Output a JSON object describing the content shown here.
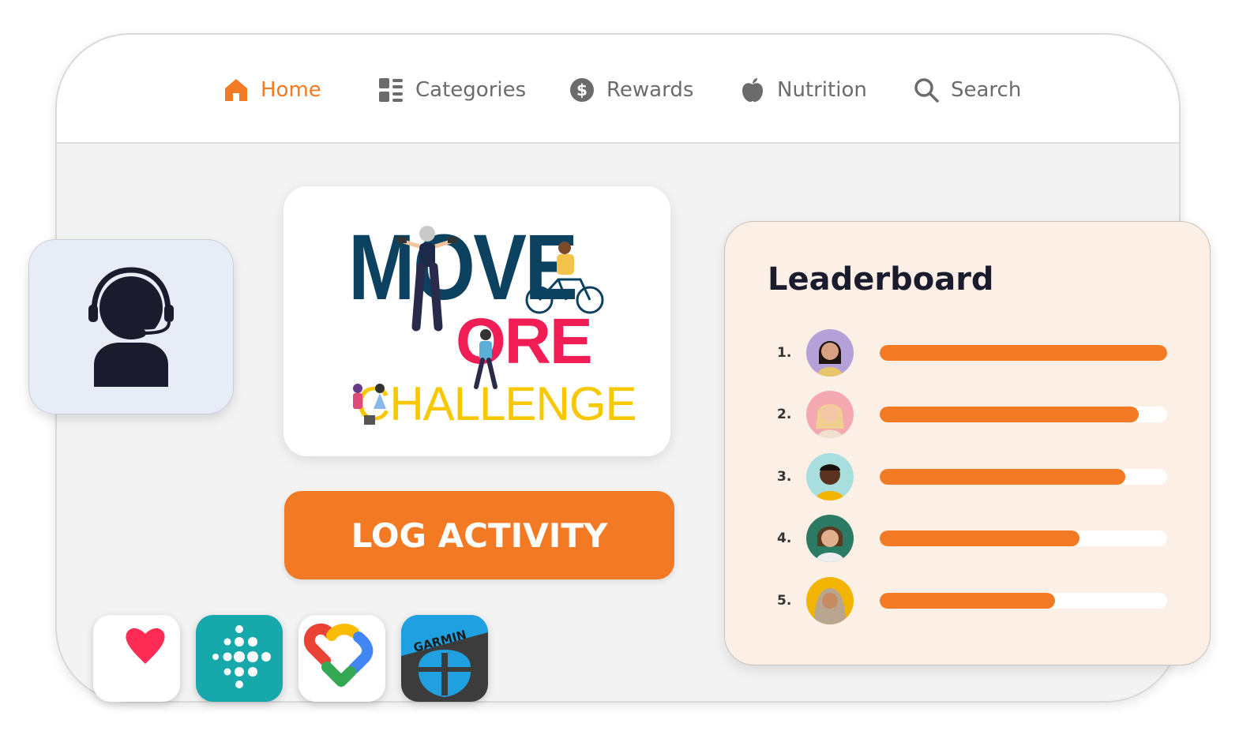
{
  "nav": {
    "items": [
      {
        "label": "Home",
        "icon": "home-icon",
        "active": true
      },
      {
        "label": "Categories",
        "icon": "categories-icon",
        "active": false
      },
      {
        "label": "Rewards",
        "icon": "dollar-coin-icon",
        "active": false
      },
      {
        "label": "Nutrition",
        "icon": "apple-icon",
        "active": false
      },
      {
        "label": "Search",
        "icon": "search-icon",
        "active": false
      }
    ]
  },
  "challenge": {
    "logo_line1": "MOVE",
    "logo_line2": "ORE",
    "logo_line3": "CHALLENGE"
  },
  "log_button": {
    "label": "LOG ACTIVITY"
  },
  "apps": [
    {
      "name": "apple-health-icon"
    },
    {
      "name": "fitbit-icon"
    },
    {
      "name": "google-fit-icon"
    },
    {
      "name": "garmin-connect-icon",
      "label": "GARMIN"
    }
  ],
  "leaderboard": {
    "title": "Leaderboard",
    "entries": [
      {
        "rank": "1.",
        "progress": 1.0,
        "avatar_bg": "#b6a0d8"
      },
      {
        "rank": "2.",
        "progress": 0.9,
        "avatar_bg": "#f4a8b0"
      },
      {
        "rank": "3.",
        "progress": 0.855,
        "avatar_bg": "#a8dede"
      },
      {
        "rank": "4.",
        "progress": 0.695,
        "avatar_bg": "#2a7a64"
      },
      {
        "rank": "5.",
        "progress": 0.61,
        "avatar_bg": "#f2b400"
      }
    ]
  },
  "colors": {
    "accent": "#f27a24",
    "navy": "#0d4160",
    "pink": "#f01e55",
    "yellow": "#f7c800"
  }
}
